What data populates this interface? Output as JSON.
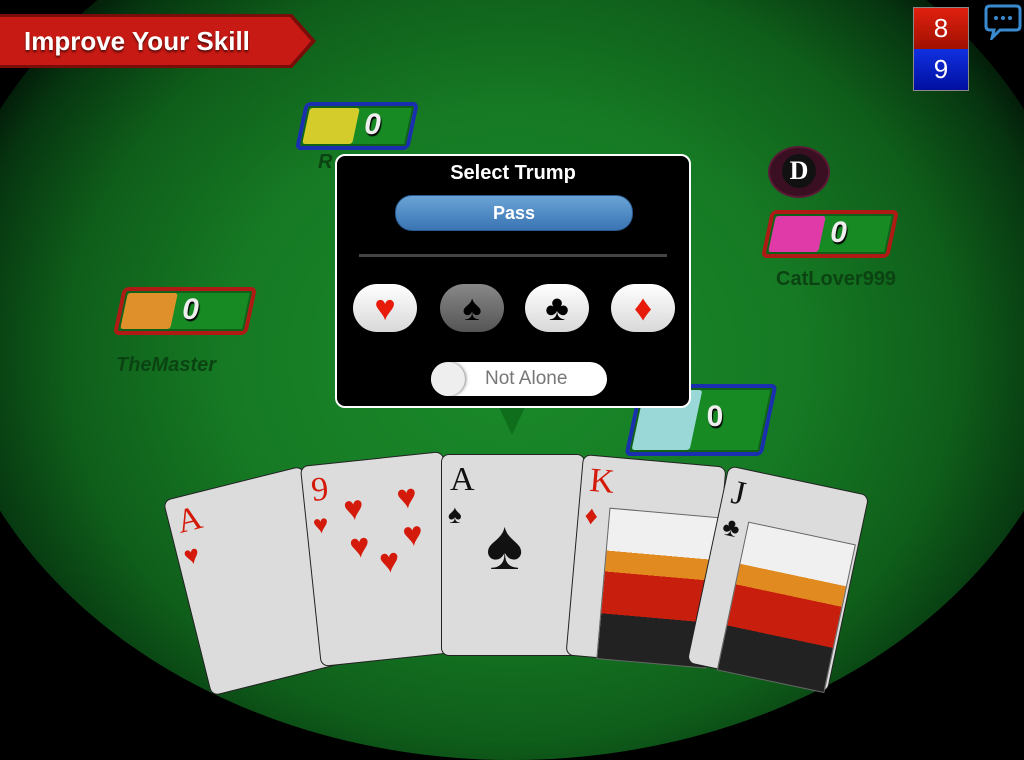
{
  "banner": {
    "label": "Improve Your Skill",
    "color": "#c81a14"
  },
  "score": {
    "team_red": "8",
    "team_blue": "9"
  },
  "chat": {
    "icon": "chat-bubble-icon"
  },
  "players": [
    {
      "name": "R",
      "score": "0",
      "team": "blue",
      "avatar": "bearded-man"
    },
    {
      "name": "CatLover999",
      "score": "0",
      "team": "red",
      "avatar": "cat-with-hat",
      "dealer": true
    },
    {
      "name": "TheMaster",
      "score": "0",
      "team": "red",
      "avatar": "hooded-master"
    },
    {
      "name": "",
      "score": "0",
      "team": "blue",
      "avatar": "woman-glasses"
    }
  ],
  "dealer": {
    "label": "D"
  },
  "dialog": {
    "title": "Select Trump",
    "pass_label": "Pass",
    "suits": [
      {
        "name": "hearts",
        "glyph": "♥",
        "selected": false
      },
      {
        "name": "spades",
        "glyph": "♠",
        "selected": true
      },
      {
        "name": "clubs",
        "glyph": "♣",
        "selected": false
      },
      {
        "name": "diamonds",
        "glyph": "♦",
        "selected": false
      }
    ],
    "toggle_label": "Not Alone",
    "toggle_on": false
  },
  "hand": [
    {
      "rank": "A",
      "suit": "♥",
      "color": "red"
    },
    {
      "rank": "9",
      "suit": "♥",
      "color": "red"
    },
    {
      "rank": "A",
      "suit": "♠",
      "color": "black"
    },
    {
      "rank": "K",
      "suit": "♦",
      "color": "red"
    },
    {
      "rank": "J",
      "suit": "♣",
      "color": "black"
    }
  ]
}
